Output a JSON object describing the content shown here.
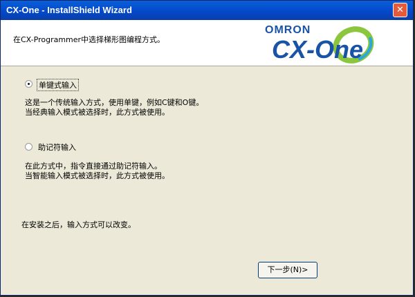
{
  "window": {
    "title": "CX-One - InstallShield Wizard",
    "close_glyph": "✕"
  },
  "header": {
    "instruction": "在CX-Programmer中选择梯形图编程方式。",
    "logo_brand": "OMRON",
    "logo_product": "CX-One"
  },
  "options": [
    {
      "label": "单键式输入",
      "selected": true,
      "description_line1": "这是一个传统输入方式，使用单键，例如C键和O键。",
      "description_line2": "当经典输入模式被选择时，此方式被使用。"
    },
    {
      "label": "助记符输入",
      "selected": false,
      "description_line1": "在此方式中，指令直接通过助记符输入。",
      "description_line2": "当智能输入模式被选择时，此方式被使用。"
    }
  ],
  "note": "在安装之后，输入方式可以改变。",
  "buttons": {
    "next_label": "下一步(N)>"
  },
  "colors": {
    "titlebar": "#0347c9",
    "window_bg": "#ece9d8",
    "logo_blue": "#1953a7",
    "close_red": "#e45a3a"
  }
}
